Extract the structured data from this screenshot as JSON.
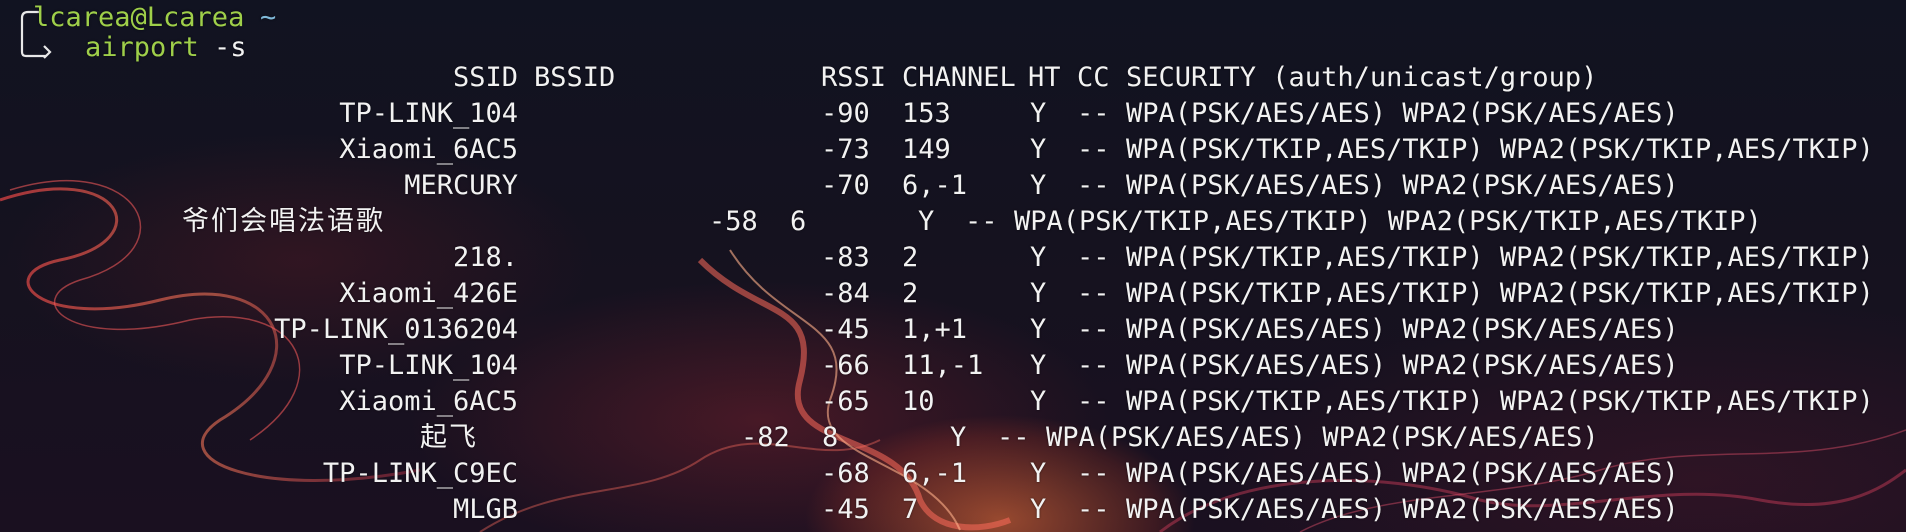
{
  "prompt": {
    "user_host": "lcarea@Lcarea",
    "cwd": "~",
    "command": "airport",
    "args": "-s"
  },
  "table": {
    "headers": {
      "ssid": "SSID",
      "bssid": "BSSID",
      "rssi": "RSSI",
      "channel": "CHANNEL",
      "ht": "HT",
      "cc": "CC",
      "security": "SECURITY (auth/unicast/group)"
    },
    "rows": [
      {
        "ssid": "TP-LINK_104",
        "rssi": "-90",
        "channel": "153",
        "ht": "Y",
        "cc": "--",
        "security": "WPA(PSK/AES/AES) WPA2(PSK/AES/AES)"
      },
      {
        "ssid": "Xiaomi_6AC5",
        "rssi": "-73",
        "channel": "149",
        "ht": "Y",
        "cc": "--",
        "security": "WPA(PSK/TKIP,AES/TKIP) WPA2(PSK/TKIP,AES/TKIP)"
      },
      {
        "ssid": "MERCURY",
        "rssi": "-70",
        "channel": "6,-1",
        "ht": "Y",
        "cc": "--",
        "security": "WPA(PSK/AES/AES) WPA2(PSK/AES/AES)"
      },
      {
        "ssid": "爷们会唱法语歌",
        "rssi": "-58",
        "channel": "6",
        "ht": "Y",
        "cc": "--",
        "security": "WPA(PSK/TKIP,AES/TKIP) WPA2(PSK/TKIP,AES/TKIP)",
        "shift": "cjk7"
      },
      {
        "ssid": "218.",
        "rssi": "-83",
        "channel": "2",
        "ht": "Y",
        "cc": "--",
        "security": "WPA(PSK/TKIP,AES/TKIP) WPA2(PSK/TKIP,AES/TKIP)"
      },
      {
        "ssid": "Xiaomi_426E",
        "rssi": "-84",
        "channel": "2",
        "ht": "Y",
        "cc": "--",
        "security": "WPA(PSK/TKIP,AES/TKIP) WPA2(PSK/TKIP,AES/TKIP)"
      },
      {
        "ssid": "TP-LINK_0136204",
        "rssi": "-45",
        "channel": "1,+1",
        "ht": "Y",
        "cc": "--",
        "security": "WPA(PSK/AES/AES) WPA2(PSK/AES/AES)"
      },
      {
        "ssid": "TP-LINK_104",
        "rssi": "-66",
        "channel": "11,-1",
        "ht": "Y",
        "cc": "--",
        "security": "WPA(PSK/AES/AES) WPA2(PSK/AES/AES)"
      },
      {
        "ssid": "Xiaomi_6AC5",
        "rssi": "-65",
        "channel": "10",
        "ht": "Y",
        "cc": "--",
        "security": "WPA(PSK/TKIP,AES/TKIP) WPA2(PSK/TKIP,AES/TKIP)"
      },
      {
        "ssid": "起飞",
        "rssi": "-82",
        "channel": "8",
        "ht": "Y",
        "cc": "--",
        "security": "WPA(PSK/AES/AES) WPA2(PSK/AES/AES)",
        "shift": "cjk2"
      },
      {
        "ssid": "TP-LINK_C9EC",
        "rssi": "-68",
        "channel": "6,-1",
        "ht": "Y",
        "cc": "--",
        "security": "WPA(PSK/AES/AES) WPA2(PSK/AES/AES)"
      },
      {
        "ssid": "MLGB",
        "rssi": "-45",
        "channel": "7",
        "ht": "Y",
        "cc": "--",
        "security": "WPA(PSK/AES/AES) WPA2(PSK/AES/AES)"
      }
    ]
  },
  "colors": {
    "prompt_green": "#9fcf4a",
    "text": "#f2f2f2",
    "background": "#111321"
  },
  "icons": {
    "prompt_arrow": "corner-arrow-icon"
  }
}
